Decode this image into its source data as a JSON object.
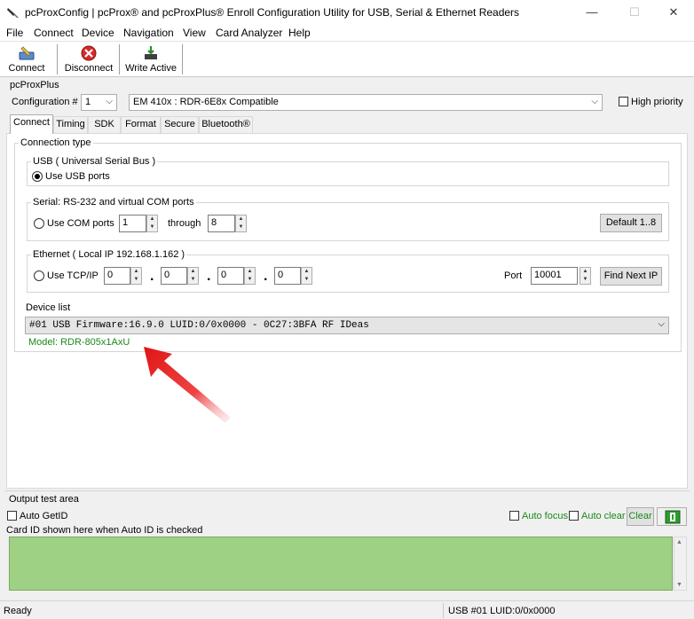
{
  "window": {
    "title": "pcProxConfig |  pcProx® and pcProxPlus® Enroll Configuration Utility for USB, Serial & Ethernet Readers",
    "minimize": "—",
    "maximize": "☐",
    "close": "✕"
  },
  "menu": [
    "File",
    "Connect",
    "Device",
    "Navigation",
    "View",
    "Card Analyzer",
    "Help"
  ],
  "toolbar": {
    "connect_label": "Connect",
    "disconnect_label": "Disconnect",
    "write_active_label": "Write Active"
  },
  "config": {
    "group_title": "pcProxPlus",
    "configuration_label": "Configuration #",
    "configuration_value": "1",
    "card_type_value": "EM 410x : RDR-6E8x Compatible",
    "high_priority_label": "High priority",
    "high_priority_checked": false
  },
  "tabs": [
    "Connect",
    "Timing",
    "SDK",
    "Format",
    "Secure",
    "Bluetooth®"
  ],
  "active_tab": "Connect",
  "connect": {
    "connection_type_label": "Connection type",
    "usb": {
      "legend": "USB ( Universal Serial Bus )",
      "radio_label": "Use USB ports",
      "selected": true
    },
    "serial": {
      "legend": "Serial: RS-232 and virtual COM ports",
      "radio_label": "Use COM ports",
      "from_value": "1",
      "through_label": "through",
      "to_value": "8",
      "default_button": "Default 1..8"
    },
    "ethernet": {
      "legend": "Ethernet ( Local IP 192.168.1.162 )",
      "radio_label": "Use TCP/IP",
      "ip_octets": [
        "0",
        "0",
        "0",
        "0"
      ],
      "port_label": "Port",
      "port_value": "10001",
      "find_button": "Find Next IP"
    },
    "device_list_label": "Device list",
    "device_list_value": "#01 USB Firmware:16.9.0 LUID:0/0x0000 - 0C27:3BFA RF IDeas",
    "model_text": "Model: RDR-805x1AxU"
  },
  "output": {
    "group_title": "Output test area",
    "auto_getid_label": "Auto GetID",
    "auto_focus_label": "Auto focus",
    "auto_clear_label": "Auto clear",
    "clear_button": "Clear",
    "card_id_caption": "Card ID shown here when Auto ID is checked"
  },
  "status": {
    "left_text": "Ready",
    "right_text": "USB #01 LUID:0/0x0000"
  },
  "colors": {
    "green_output": "#9fd184",
    "model_text": "#1a8a1a",
    "arrow_red": "#e02020"
  },
  "icons": [
    "app-icon",
    "connect-icon",
    "disconnect-icon",
    "write-active-icon",
    "copy-icon",
    "red-arrow-annotation"
  ]
}
